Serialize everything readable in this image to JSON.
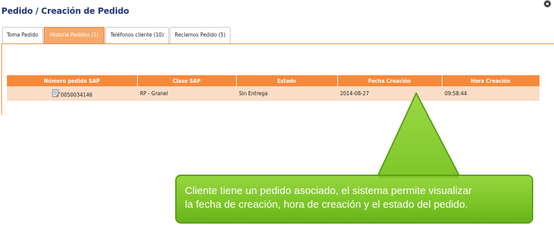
{
  "page": {
    "title": "Pedido / Creación de Pedido"
  },
  "tabs": [
    {
      "label": "Toma Pedido",
      "active": false
    },
    {
      "label": "Historia Pedidos (1)",
      "active": true
    },
    {
      "label": "Teléfonos cliente (10)",
      "active": false
    },
    {
      "label": "Reclamos Pedido (5)",
      "active": false
    }
  ],
  "orders_table": {
    "headers": [
      "Número pedido SAP",
      "Clase SAP",
      "Estado",
      "Fecha Creación",
      "Hora Creación"
    ],
    "rows": [
      {
        "numero": "0050034146",
        "clase": "RP - Granel",
        "estado": "Sin Entrega",
        "fecha": "2014-08-27",
        "hora": "09:58:44"
      }
    ]
  },
  "callout": {
    "line1": "Cliente tiene un pedido asociado, el sistema permite visualizar",
    "line2": "la fecha de creación, hora de creación y el estado del pedido."
  },
  "colors": {
    "accent": "#f7893b",
    "row": "#f9ddc7",
    "callout": "#7ec62a",
    "title": "#26367a"
  },
  "icons": {
    "row_icon": "edit-document-icon",
    "corner_icon": "help-icon"
  }
}
